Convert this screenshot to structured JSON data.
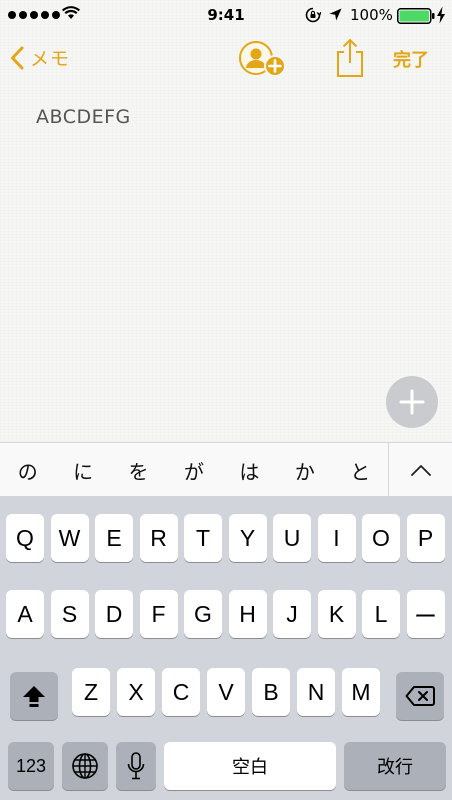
{
  "status_bar": {
    "time": "9:41",
    "battery_percent": "100%",
    "battery_level": 1.0,
    "signal_bars": 5
  },
  "nav": {
    "back_label": "メモ",
    "done_label": "完了",
    "icons": {
      "back": "chevron-left-icon",
      "add_person": "add-person-icon",
      "share": "share-icon"
    },
    "accent_color": "#e3a617"
  },
  "note": {
    "text": "ABCDEFG"
  },
  "candidates": [
    "の",
    "に",
    "を",
    "が",
    "は",
    "か",
    "と"
  ],
  "keyboard": {
    "row1": [
      "Q",
      "W",
      "E",
      "R",
      "T",
      "Y",
      "U",
      "I",
      "O",
      "P"
    ],
    "row2": [
      "A",
      "S",
      "D",
      "F",
      "G",
      "H",
      "J",
      "K",
      "L",
      "ー"
    ],
    "row3": [
      "Z",
      "X",
      "C",
      "V",
      "B",
      "N",
      "M"
    ],
    "numbers_key": "123",
    "space_label": "空白",
    "return_label": "改行"
  }
}
